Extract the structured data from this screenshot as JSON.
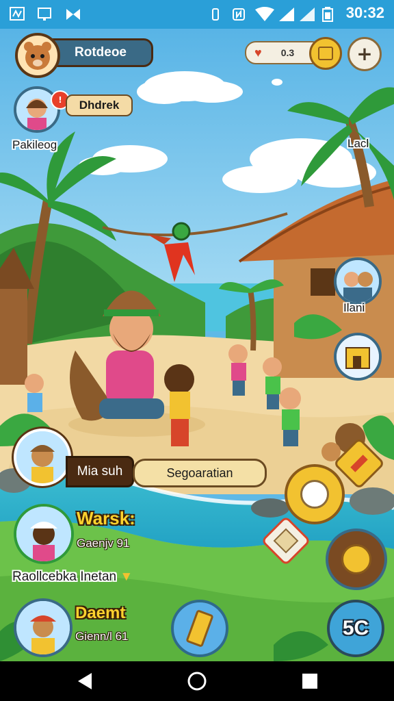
{
  "status_bar": {
    "time": "30:32",
    "left_icons": [
      "news-icon",
      "screen-icon",
      "bow-icon"
    ],
    "right_icons": [
      "vibrate-icon",
      "nfc-icon",
      "wifi-icon",
      "signal-icon",
      "battery-icon"
    ]
  },
  "player": {
    "name": "Rotdeoe"
  },
  "currency": {
    "value": "0.3"
  },
  "quest_bubble": {
    "label": "Dhdrek"
  },
  "villagers": {
    "top_left_name": "Pakileog",
    "top_right_name": "Lacl",
    "right_name": "Ilani"
  },
  "dialogue": {
    "speaker": "Mia suh",
    "action": "Segoaratian"
  },
  "roster": [
    {
      "name": "Warsk:",
      "sub": "Gaenjv 91"
    },
    {
      "name": "Daemt",
      "sub": "Gienn/l 61"
    }
  ],
  "roster_caption": "Raollcebka Inetan",
  "counter_badge": "5C",
  "colors": {
    "sky": "#5fb9e6",
    "status_bar": "#2a9fd8",
    "panel_brown": "#4a2a12",
    "accent_yellow": "#ffd22e",
    "badge_blue": "#3fa4d8"
  }
}
